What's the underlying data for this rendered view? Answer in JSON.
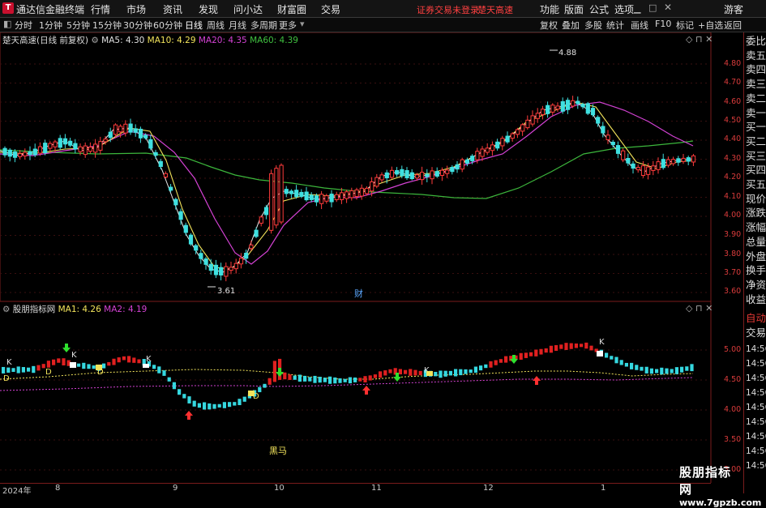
{
  "menubar": {
    "app_title": "通达信金融终端",
    "items": [
      "行情",
      "市场",
      "资讯",
      "发现",
      "问小达",
      "财富圈",
      "交易"
    ],
    "notice": "证券交易未登录",
    "stock_name_top": "楚天高速",
    "right_items": [
      "功能",
      "版面",
      "公式",
      "选项"
    ],
    "user": "游客"
  },
  "toolbar": {
    "periods": [
      "分时",
      "1分钟",
      "5分钟",
      "15分钟",
      "30分钟",
      "60分钟",
      "日线",
      "周线",
      "月线",
      "多周期",
      "更多"
    ],
    "active_period": "日线",
    "right_buttons": [
      "复权",
      "叠加",
      "多股",
      "统计",
      "画线",
      "F10",
      "标记",
      "+自选",
      "返回"
    ]
  },
  "main_chart": {
    "stock_label": "楚天高速(日线 前复权)",
    "ma_labels": [
      {
        "text": "MA5: 4.30",
        "color": "#e0e0e0"
      },
      {
        "text": "MA10: 4.29",
        "color": "#f2e35b"
      },
      {
        "text": "MA20: 4.35",
        "color": "#d442d4"
      },
      {
        "text": "MA60: 4.39",
        "color": "#40c040"
      }
    ],
    "y_ticks": [
      "4.80",
      "4.70",
      "4.60",
      "4.50",
      "4.40",
      "4.30",
      "4.20",
      "4.10",
      "4.00",
      "3.90",
      "3.80",
      "3.70",
      "3.60"
    ],
    "high_label": "4.88",
    "low_label": "3.61",
    "cai_marker": "财"
  },
  "sub_chart": {
    "indicator_label": "股朋指标网",
    "ma_labels": [
      {
        "text": "MA1: 4.26",
        "color": "#f2e35b"
      },
      {
        "text": "MA2: 4.19",
        "color": "#d442d4"
      }
    ],
    "y_ticks": [
      "5.00",
      "4.50",
      "4.00",
      "3.50",
      "3.00"
    ],
    "heima_label": "黑马",
    "k_marks": [
      "K",
      "K",
      "K",
      "K",
      "K"
    ],
    "d_marks": [
      "D",
      "D",
      "D",
      "D"
    ]
  },
  "right_panel": {
    "items": [
      "委比",
      "卖五",
      "卖四",
      "卖三",
      "卖二",
      "卖一",
      "买一",
      "买二",
      "买三",
      "买四",
      "买五",
      "现价",
      "涨跌",
      "涨幅",
      "总量",
      "外盘",
      "换手",
      "净资",
      "收益"
    ],
    "mode_label": "自动",
    "trade_label": "交易",
    "time_ticks": [
      "14:56",
      "14:56",
      "14:56",
      "14:56",
      "14:56",
      "14:56",
      "14:56",
      "14:56",
      "14:56"
    ]
  },
  "x_axis": [
    "2024年",
    "8",
    "9",
    "10",
    "11",
    "12",
    "1"
  ],
  "watermark": {
    "name": "股朋指标网",
    "url": "www.7gpzb.com"
  }
}
